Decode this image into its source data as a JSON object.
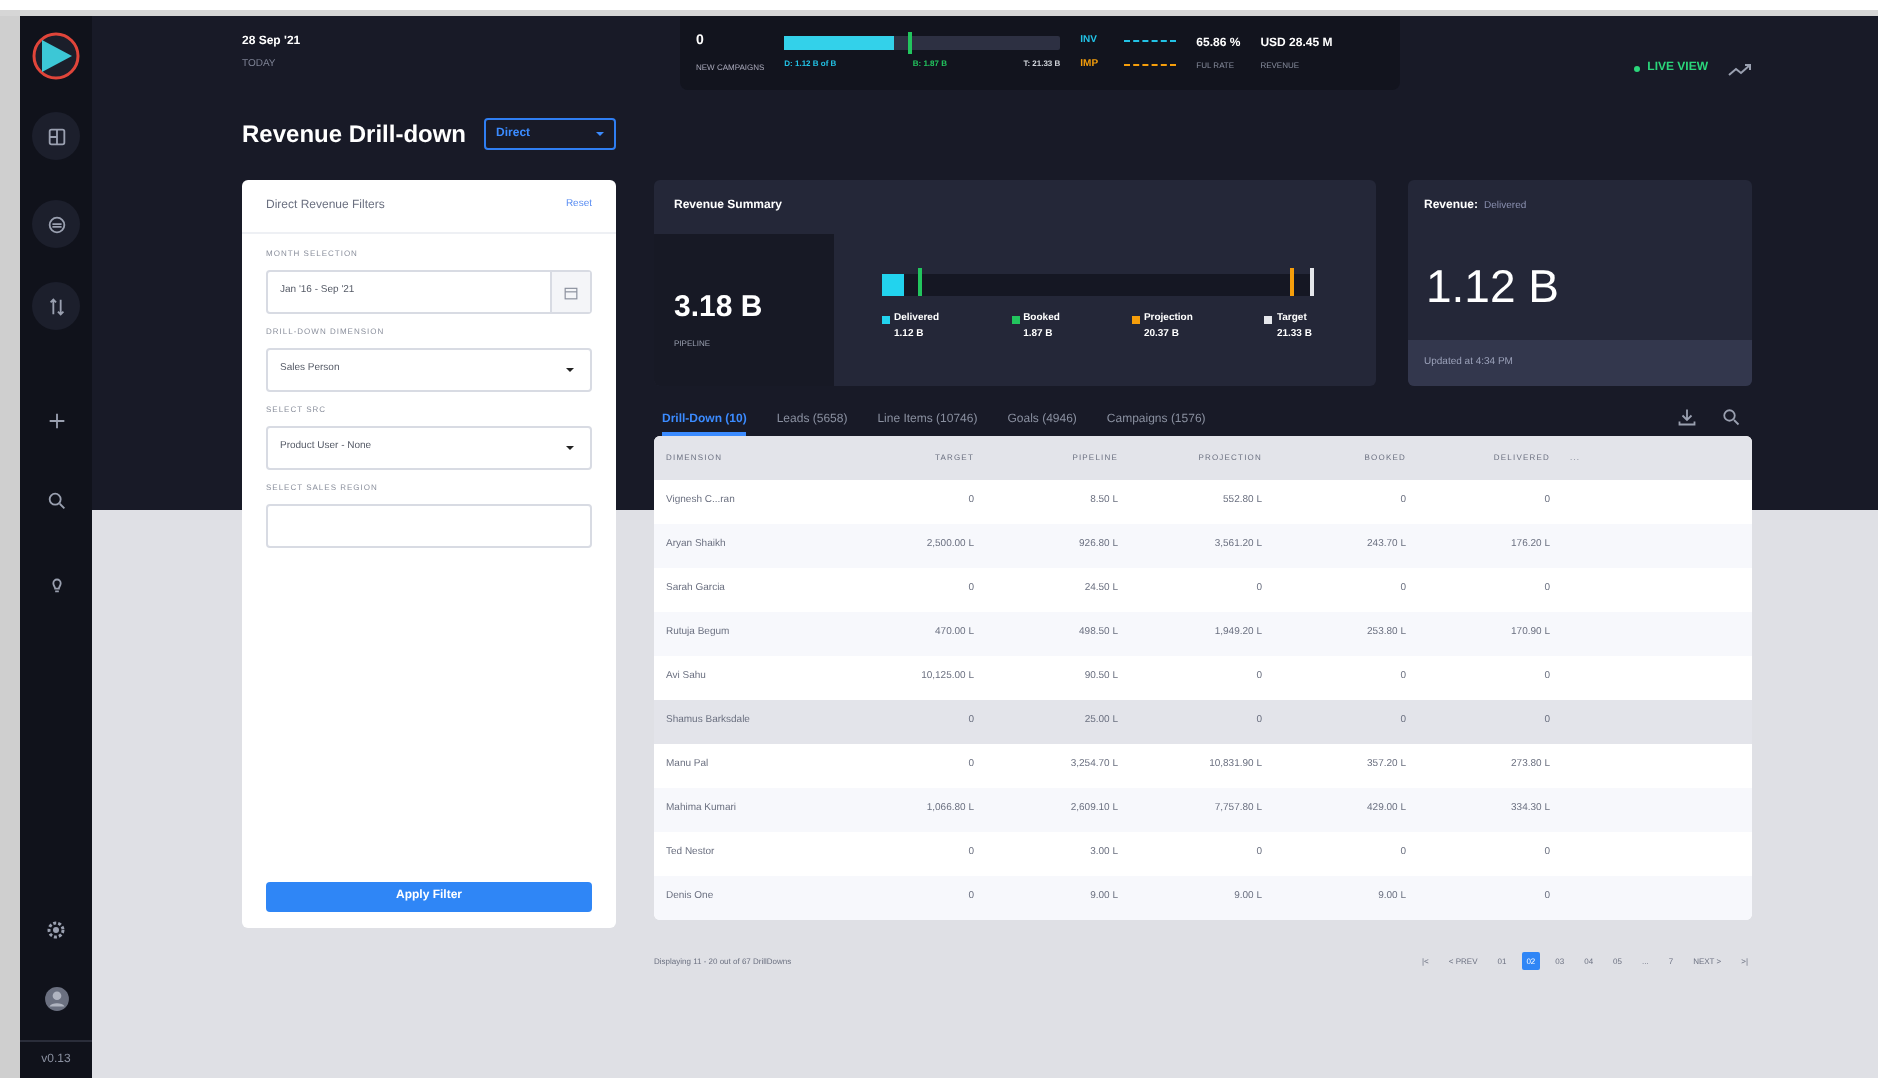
{
  "sidebar": {
    "version": "v0.13"
  },
  "header": {
    "date": "28 Sep '21",
    "date_caption": "TODAY",
    "campaigns": {
      "value": "0",
      "label": "NEW CAMPAIGNS"
    },
    "progress": {
      "level": 0.4,
      "marker": {
        "level": 0.45
      },
      "labels": [
        {
          "text": "D: 1.12 B of B",
          "color": "#22c3e6"
        },
        {
          "text": "B: 1.87 B",
          "color": "#22c55e"
        },
        {
          "text": "T: 21.33 B",
          "color": "#d1d5db"
        }
      ]
    },
    "legend": [
      {
        "label": "INV",
        "color": "#22c3e6"
      },
      {
        "label": "IMP",
        "color": "#f59e0b"
      }
    ],
    "stats": [
      {
        "value": "65.86 %",
        "label": "FUL RATE"
      },
      {
        "value": "USD 28.45 M",
        "label": "REVENUE"
      }
    ],
    "live_view": "LIVE VIEW"
  },
  "page": {
    "title": "Revenue Drill-down",
    "channel_select": "Direct"
  },
  "filters": {
    "title": "Direct Revenue Filters",
    "reset": "Reset",
    "fields": [
      {
        "kind": "date",
        "label": "MONTH SELECTION",
        "value": "Jan '16 - Sep '21"
      },
      {
        "kind": "select",
        "label": "DRILL-DOWN DIMENSION",
        "value": "Sales Person"
      },
      {
        "kind": "select",
        "label": "SELECT SRC",
        "value": "Product User - None"
      },
      {
        "kind": "text",
        "label": "SELECT SALES REGION"
      }
    ],
    "apply": "Apply Filter"
  },
  "summary": {
    "title": "Revenue Summary",
    "pipeline": "3.18 B",
    "pipeline_label": "PIPELINE",
    "bar": {
      "level": 0.05,
      "markers": [
        {
          "level": 0.088,
          "color": "#22c55e"
        },
        {
          "level": 0.955,
          "color": "#f59e0b"
        },
        {
          "level": 1,
          "color": "#e5e7eb"
        }
      ]
    },
    "items": [
      {
        "label": "Delivered",
        "value": "1.12 B",
        "color": "#22d3ee"
      },
      {
        "label": "Booked",
        "value": "1.87 B",
        "color": "#22c55e"
      },
      {
        "label": "Projection",
        "value": "20.37 B",
        "color": "#f59e0b"
      },
      {
        "label": "Target",
        "value": "21.33 B",
        "color": "#e5e7eb"
      }
    ]
  },
  "revenue_card": {
    "title": "Revenue:",
    "subtitle": "Delivered",
    "value": "1.12 B",
    "updated": "Updated at 4:34 PM"
  },
  "tabs": [
    {
      "label": "Drill-Down (10)",
      "selected": true
    },
    {
      "label": "Leads (5658)",
      "selected": false
    },
    {
      "label": "Line Items (10746)",
      "selected": false
    },
    {
      "label": "Goals (4946)",
      "selected": false
    },
    {
      "label": "Campaigns (1576)",
      "selected": false
    }
  ],
  "table": {
    "columns": [
      "DIMENSION",
      "TARGET",
      "PIPELINE",
      "PROJECTION",
      "BOOKED",
      "DELIVERED",
      "..."
    ],
    "rows": [
      {
        "cells": [
          "Vignesh C...ran",
          "0",
          "8.50 L",
          "552.80 L",
          "0",
          "0"
        ],
        "selected": false
      },
      {
        "cells": [
          "Aryan Shaikh",
          "2,500.00 L",
          "926.80 L",
          "3,561.20 L",
          "243.70 L",
          "176.20 L"
        ],
        "selected": false
      },
      {
        "cells": [
          "Sarah Garcia",
          "0",
          "24.50 L",
          "0",
          "0",
          "0"
        ],
        "selected": false
      },
      {
        "cells": [
          "Rutuja Begum",
          "470.00 L",
          "498.50 L",
          "1,949.20 L",
          "253.80 L",
          "170.90 L"
        ],
        "selected": false
      },
      {
        "cells": [
          "Avi Sahu",
          "10,125.00 L",
          "90.50 L",
          "0",
          "0",
          "0"
        ],
        "selected": false
      },
      {
        "cells": [
          "Shamus Barksdale",
          "0",
          "25.00 L",
          "0",
          "0",
          "0"
        ],
        "selected": true
      },
      {
        "cells": [
          "Manu Pal",
          "0",
          "3,254.70 L",
          "10,831.90 L",
          "357.20 L",
          "273.80 L"
        ],
        "selected": false
      },
      {
        "cells": [
          "Mahima Kumari",
          "1,066.80 L",
          "2,609.10 L",
          "7,757.80 L",
          "429.00 L",
          "334.30 L"
        ],
        "selected": false
      },
      {
        "cells": [
          "Ted Nestor",
          "0",
          "3.00 L",
          "0",
          "0",
          "0"
        ],
        "selected": false
      },
      {
        "cells": [
          "Denis One",
          "0",
          "9.00 L",
          "9.00 L",
          "9.00 L",
          "0"
        ],
        "selected": false
      }
    ]
  },
  "footer": {
    "summary": "Displaying 11 - 20 out of 67 DrillDowns",
    "pagination": [
      {
        "label": "|<",
        "selected": false
      },
      {
        "label": "< PREV",
        "selected": false
      },
      {
        "label": "01",
        "selected": false
      },
      {
        "label": "02",
        "selected": true
      },
      {
        "label": "03",
        "selected": false
      },
      {
        "label": "04",
        "selected": false
      },
      {
        "label": "05",
        "selected": false
      },
      {
        "label": "...",
        "selected": false
      },
      {
        "label": "7",
        "selected": false
      },
      {
        "label": "NEXT >",
        "selected": false
      },
      {
        "label": ">|",
        "selected": false
      }
    ]
  }
}
